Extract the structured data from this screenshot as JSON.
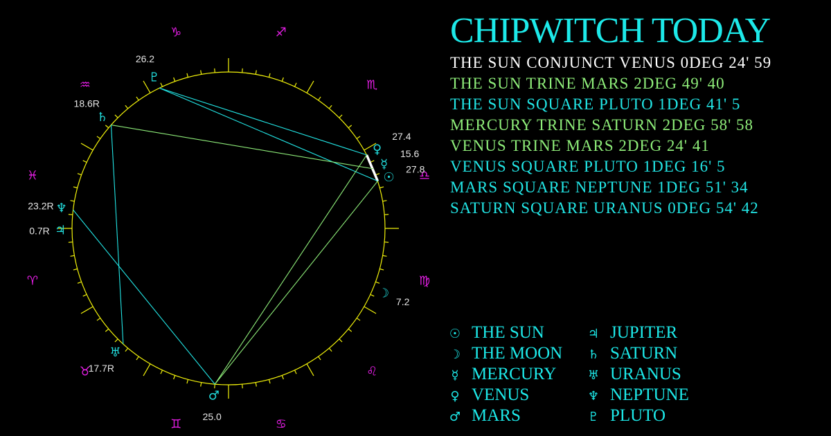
{
  "title": "CHIPWITCH TODAY",
  "colors": {
    "background": "#000000",
    "title": "#1de9e9",
    "wheel": "#f2f20a",
    "zodiac": "#e61ee6",
    "planet": "#22dddd",
    "degree_label": "#e6e6e6",
    "legend": "#1de9e9",
    "conjunct": "#ffffff",
    "trine": "#8fee7a",
    "square": "#22e6e6"
  },
  "aspects": [
    {
      "label": "THE SUN CONJUNCT VENUS 0DEG 24' 59",
      "planet1": "sun",
      "type": "conjunct",
      "planet2": "venus",
      "orb": {
        "deg": 0,
        "min": 24,
        "sec": 59
      }
    },
    {
      "label": "THE SUN TRINE MARS 2DEG 49' 40",
      "planet1": "sun",
      "type": "trine",
      "planet2": "mars",
      "orb": {
        "deg": 2,
        "min": 49,
        "sec": 40
      }
    },
    {
      "label": "THE SUN SQUARE PLUTO 1DEG 41' 5",
      "planet1": "sun",
      "type": "square",
      "planet2": "pluto",
      "orb": {
        "deg": 1,
        "min": 41,
        "sec": 5
      }
    },
    {
      "label": "MERCURY TRINE SATURN 2DEG 58' 58",
      "planet1": "mercury",
      "type": "trine",
      "planet2": "saturn",
      "orb": {
        "deg": 2,
        "min": 58,
        "sec": 58
      }
    },
    {
      "label": "VENUS TRINE MARS 2DEG 24' 41",
      "planet1": "venus",
      "type": "trine",
      "planet2": "mars",
      "orb": {
        "deg": 2,
        "min": 24,
        "sec": 41
      }
    },
    {
      "label": "VENUS SQUARE PLUTO 1DEG 16' 5",
      "planet1": "venus",
      "type": "square",
      "planet2": "pluto",
      "orb": {
        "deg": 1,
        "min": 16,
        "sec": 5
      }
    },
    {
      "label": "MARS SQUARE NEPTUNE 1DEG 51' 34",
      "planet1": "mars",
      "type": "square",
      "planet2": "neptune",
      "orb": {
        "deg": 1,
        "min": 51,
        "sec": 34
      }
    },
    {
      "label": "SATURN SQUARE URANUS 0DEG 54' 42",
      "planet1": "saturn",
      "type": "square",
      "planet2": "uranus",
      "orb": {
        "deg": 0,
        "min": 54,
        "sec": 42
      }
    }
  ],
  "legend": [
    {
      "id": "sun",
      "glyph": "☉",
      "name": "THE SUN"
    },
    {
      "id": "moon",
      "glyph": "☽",
      "name": "THE MOON"
    },
    {
      "id": "mercury",
      "glyph": "☿",
      "name": "MERCURY"
    },
    {
      "id": "venus",
      "glyph": "♀",
      "name": "VENUS"
    },
    {
      "id": "mars",
      "glyph": "♂",
      "name": "MARS"
    },
    {
      "id": "jupiter",
      "glyph": "♃",
      "name": "JUPITER"
    },
    {
      "id": "saturn",
      "glyph": "♄",
      "name": "SATURN"
    },
    {
      "id": "uranus",
      "glyph": "♅",
      "name": "URANUS"
    },
    {
      "id": "neptune",
      "glyph": "♆",
      "name": "NEPTUNE"
    },
    {
      "id": "pluto",
      "glyph": "♇",
      "name": "PLUTO"
    }
  ],
  "wheel": {
    "zodiac": [
      {
        "id": "aries",
        "glyph": "♈"
      },
      {
        "id": "taurus",
        "glyph": "♉"
      },
      {
        "id": "gemini",
        "glyph": "♊"
      },
      {
        "id": "cancer",
        "glyph": "♋"
      },
      {
        "id": "leo",
        "glyph": "♌"
      },
      {
        "id": "virgo",
        "glyph": "♍"
      },
      {
        "id": "libra",
        "glyph": "♎"
      },
      {
        "id": "scorpio",
        "glyph": "♏"
      },
      {
        "id": "sagittarius",
        "glyph": "♐"
      },
      {
        "id": "capricorn",
        "glyph": "♑"
      },
      {
        "id": "aquarius",
        "glyph": "♒"
      },
      {
        "id": "pisces",
        "glyph": "♓"
      }
    ],
    "planets": [
      {
        "id": "sun",
        "glyph": "☉",
        "sign": "libra",
        "degree": 27.8,
        "retrograde": false,
        "label": "27.8"
      },
      {
        "id": "moon",
        "glyph": "☽",
        "sign": "virgo",
        "degree": 7.2,
        "retrograde": false,
        "label": "7.2"
      },
      {
        "id": "mercury",
        "glyph": "☿",
        "sign": "libra",
        "degree": 15.6,
        "retrograde": false,
        "label": "15.6"
      },
      {
        "id": "venus",
        "glyph": "♀",
        "sign": "libra",
        "degree": 27.4,
        "retrograde": false,
        "label": "27.4"
      },
      {
        "id": "mars",
        "glyph": "♂",
        "sign": "gemini",
        "degree": 25.0,
        "retrograde": false,
        "label": "25.0"
      },
      {
        "id": "jupiter",
        "glyph": "♃",
        "sign": "aries",
        "degree": 0.7,
        "retrograde": true,
        "label": "0.7R"
      },
      {
        "id": "saturn",
        "glyph": "♄",
        "sign": "aquarius",
        "degree": 18.6,
        "retrograde": true,
        "label": "18.6R"
      },
      {
        "id": "uranus",
        "glyph": "♅",
        "sign": "taurus",
        "degree": 17.7,
        "retrograde": true,
        "label": "17.7R"
      },
      {
        "id": "neptune",
        "glyph": "♆",
        "sign": "pisces",
        "degree": 23.2,
        "retrograde": true,
        "label": "23.2R"
      },
      {
        "id": "pluto",
        "glyph": "♇",
        "sign": "capricorn",
        "degree": 26.2,
        "retrograde": false,
        "label": "26.2"
      }
    ]
  }
}
